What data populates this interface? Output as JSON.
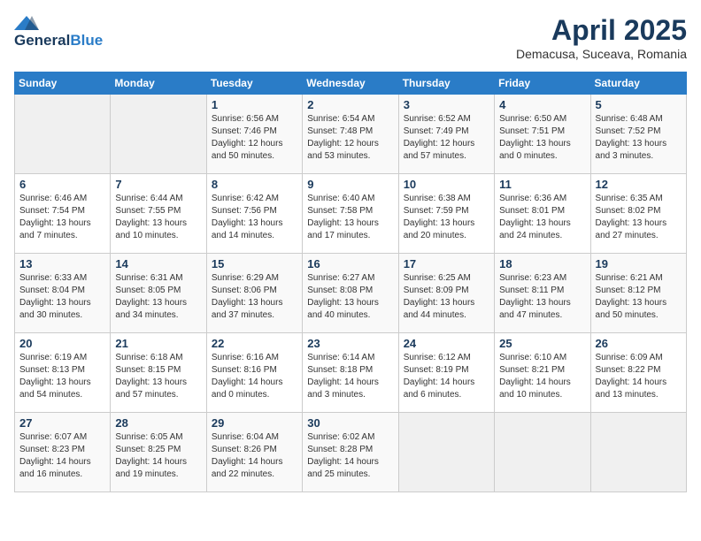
{
  "logo": {
    "line1": "General",
    "line2": "Blue"
  },
  "title": "April 2025",
  "subtitle": "Demacusa, Suceava, Romania",
  "days_of_week": [
    "Sunday",
    "Monday",
    "Tuesday",
    "Wednesday",
    "Thursday",
    "Friday",
    "Saturday"
  ],
  "weeks": [
    [
      {
        "day": "",
        "info": ""
      },
      {
        "day": "",
        "info": ""
      },
      {
        "day": "1",
        "info": "Sunrise: 6:56 AM\nSunset: 7:46 PM\nDaylight: 12 hours\nand 50 minutes."
      },
      {
        "day": "2",
        "info": "Sunrise: 6:54 AM\nSunset: 7:48 PM\nDaylight: 12 hours\nand 53 minutes."
      },
      {
        "day": "3",
        "info": "Sunrise: 6:52 AM\nSunset: 7:49 PM\nDaylight: 12 hours\nand 57 minutes."
      },
      {
        "day": "4",
        "info": "Sunrise: 6:50 AM\nSunset: 7:51 PM\nDaylight: 13 hours\nand 0 minutes."
      },
      {
        "day": "5",
        "info": "Sunrise: 6:48 AM\nSunset: 7:52 PM\nDaylight: 13 hours\nand 3 minutes."
      }
    ],
    [
      {
        "day": "6",
        "info": "Sunrise: 6:46 AM\nSunset: 7:54 PM\nDaylight: 13 hours\nand 7 minutes."
      },
      {
        "day": "7",
        "info": "Sunrise: 6:44 AM\nSunset: 7:55 PM\nDaylight: 13 hours\nand 10 minutes."
      },
      {
        "day": "8",
        "info": "Sunrise: 6:42 AM\nSunset: 7:56 PM\nDaylight: 13 hours\nand 14 minutes."
      },
      {
        "day": "9",
        "info": "Sunrise: 6:40 AM\nSunset: 7:58 PM\nDaylight: 13 hours\nand 17 minutes."
      },
      {
        "day": "10",
        "info": "Sunrise: 6:38 AM\nSunset: 7:59 PM\nDaylight: 13 hours\nand 20 minutes."
      },
      {
        "day": "11",
        "info": "Sunrise: 6:36 AM\nSunset: 8:01 PM\nDaylight: 13 hours\nand 24 minutes."
      },
      {
        "day": "12",
        "info": "Sunrise: 6:35 AM\nSunset: 8:02 PM\nDaylight: 13 hours\nand 27 minutes."
      }
    ],
    [
      {
        "day": "13",
        "info": "Sunrise: 6:33 AM\nSunset: 8:04 PM\nDaylight: 13 hours\nand 30 minutes."
      },
      {
        "day": "14",
        "info": "Sunrise: 6:31 AM\nSunset: 8:05 PM\nDaylight: 13 hours\nand 34 minutes."
      },
      {
        "day": "15",
        "info": "Sunrise: 6:29 AM\nSunset: 8:06 PM\nDaylight: 13 hours\nand 37 minutes."
      },
      {
        "day": "16",
        "info": "Sunrise: 6:27 AM\nSunset: 8:08 PM\nDaylight: 13 hours\nand 40 minutes."
      },
      {
        "day": "17",
        "info": "Sunrise: 6:25 AM\nSunset: 8:09 PM\nDaylight: 13 hours\nand 44 minutes."
      },
      {
        "day": "18",
        "info": "Sunrise: 6:23 AM\nSunset: 8:11 PM\nDaylight: 13 hours\nand 47 minutes."
      },
      {
        "day": "19",
        "info": "Sunrise: 6:21 AM\nSunset: 8:12 PM\nDaylight: 13 hours\nand 50 minutes."
      }
    ],
    [
      {
        "day": "20",
        "info": "Sunrise: 6:19 AM\nSunset: 8:13 PM\nDaylight: 13 hours\nand 54 minutes."
      },
      {
        "day": "21",
        "info": "Sunrise: 6:18 AM\nSunset: 8:15 PM\nDaylight: 13 hours\nand 57 minutes."
      },
      {
        "day": "22",
        "info": "Sunrise: 6:16 AM\nSunset: 8:16 PM\nDaylight: 14 hours\nand 0 minutes."
      },
      {
        "day": "23",
        "info": "Sunrise: 6:14 AM\nSunset: 8:18 PM\nDaylight: 14 hours\nand 3 minutes."
      },
      {
        "day": "24",
        "info": "Sunrise: 6:12 AM\nSunset: 8:19 PM\nDaylight: 14 hours\nand 6 minutes."
      },
      {
        "day": "25",
        "info": "Sunrise: 6:10 AM\nSunset: 8:21 PM\nDaylight: 14 hours\nand 10 minutes."
      },
      {
        "day": "26",
        "info": "Sunrise: 6:09 AM\nSunset: 8:22 PM\nDaylight: 14 hours\nand 13 minutes."
      }
    ],
    [
      {
        "day": "27",
        "info": "Sunrise: 6:07 AM\nSunset: 8:23 PM\nDaylight: 14 hours\nand 16 minutes."
      },
      {
        "day": "28",
        "info": "Sunrise: 6:05 AM\nSunset: 8:25 PM\nDaylight: 14 hours\nand 19 minutes."
      },
      {
        "day": "29",
        "info": "Sunrise: 6:04 AM\nSunset: 8:26 PM\nDaylight: 14 hours\nand 22 minutes."
      },
      {
        "day": "30",
        "info": "Sunrise: 6:02 AM\nSunset: 8:28 PM\nDaylight: 14 hours\nand 25 minutes."
      },
      {
        "day": "",
        "info": ""
      },
      {
        "day": "",
        "info": ""
      },
      {
        "day": "",
        "info": ""
      }
    ]
  ]
}
